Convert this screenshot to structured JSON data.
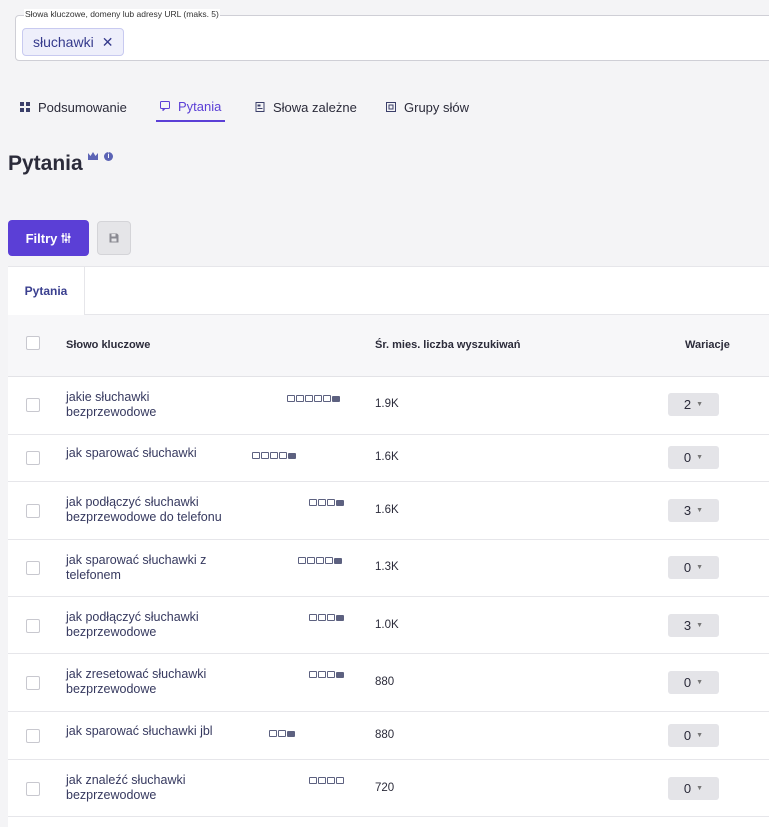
{
  "keywords_field": {
    "legend": "Słowa kluczowe, domeny lub adresy URL (maks. 5)",
    "chips": [
      {
        "label": "słuchawki",
        "remove": "✕"
      }
    ]
  },
  "tabs": [
    {
      "label": "Podsumowanie",
      "icon": "grid-icon",
      "active": false
    },
    {
      "label": "Pytania",
      "icon": "question-bubble-icon",
      "active": true
    },
    {
      "label": "Słowa zależne",
      "icon": "document-icon",
      "active": false
    },
    {
      "label": "Grupy słów",
      "icon": "cluster-icon",
      "active": false
    }
  ],
  "page": {
    "title": "Pytania",
    "info": "i"
  },
  "toolbar": {
    "filter_label": "Filtry",
    "filter_icon": "sliders-icon",
    "save_icon": "floppy-disk-icon"
  },
  "panel": {
    "tab_label": "Pytania",
    "columns": {
      "keyword": "Słowo kluczowe",
      "volume": "Śr. mies. liczba wyszukiwań",
      "variations": "Wariacje"
    },
    "rows": [
      {
        "keyword_line1": "jakie słuchawki",
        "keyword_line2": "bezprzewodowe",
        "volume": "1.9K",
        "variations": "2"
      },
      {
        "keyword_line1": "jak sparować słuchawki",
        "keyword_line2": "",
        "volume": "1.6K",
        "variations": "0"
      },
      {
        "keyword_line1": "jak podłączyć słuchawki",
        "keyword_line2": "bezprzewodowe do telefonu",
        "volume": "1.6K",
        "variations": "3"
      },
      {
        "keyword_line1": "jak sparować słuchawki z",
        "keyword_line2": "telefonem",
        "volume": "1.3K",
        "variations": "0"
      },
      {
        "keyword_line1": "jak podłączyć słuchawki",
        "keyword_line2": "bezprzewodowe",
        "volume": "1.0K",
        "variations": "3"
      },
      {
        "keyword_line1": "jak zresetować słuchawki",
        "keyword_line2": "bezprzewodowe",
        "volume": "880",
        "variations": "0"
      },
      {
        "keyword_line1": "jak sparować słuchawki jbl",
        "keyword_line2": "",
        "volume": "880",
        "variations": "0"
      },
      {
        "keyword_line1": "jak znaleźć słuchawki",
        "keyword_line2": "bezprzewodowe",
        "volume": "720",
        "variations": "0"
      }
    ]
  },
  "colors": {
    "accent": "#5b3fd6",
    "chip_text": "#353a8c",
    "background": "#f4f4f6"
  }
}
